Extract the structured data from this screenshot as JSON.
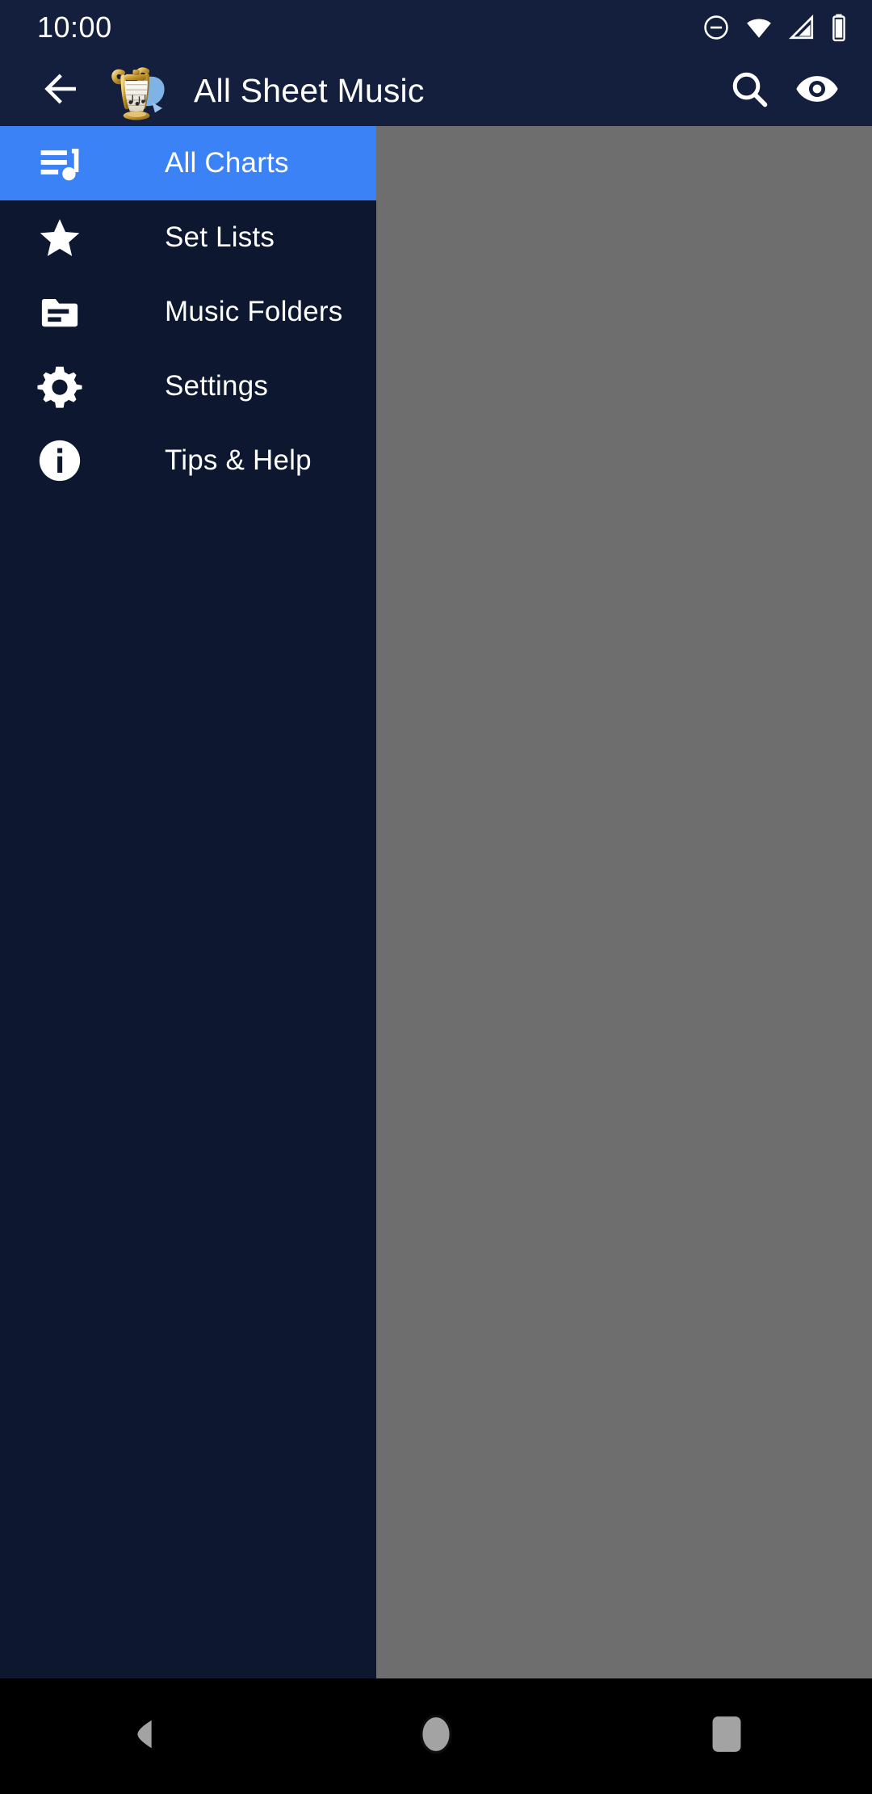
{
  "status_bar": {
    "time": "10:00",
    "icons": [
      "do-not-disturb-icon",
      "wifi-icon",
      "cell-signal-icon",
      "battery-icon"
    ]
  },
  "app_bar": {
    "back_label": "back-arrow-icon",
    "logo_label": "lyre-sheet-music-logo",
    "title": "All Sheet Music",
    "search_label": "search-icon",
    "visibility_label": "eye-icon"
  },
  "drawer": {
    "items": [
      {
        "label": "All Charts",
        "icon": "queue-music-icon",
        "selected": true
      },
      {
        "label": "Set Lists",
        "icon": "star-icon",
        "selected": false
      },
      {
        "label": "Music Folders",
        "icon": "folder-icon",
        "selected": false
      },
      {
        "label": "Settings",
        "icon": "gear-icon",
        "selected": false
      },
      {
        "label": "Tips & Help",
        "icon": "info-icon",
        "selected": false
      }
    ]
  },
  "nav_bar": {
    "back": "nav-back-icon",
    "home": "nav-home-icon",
    "recents": "nav-recents-icon"
  },
  "colors": {
    "status_bar": "#131f3d",
    "app_bar": "#131f3d",
    "drawer_bg": "#0d1730",
    "drawer_selected": "#3b82f6",
    "scrim": "#6e6e6e",
    "nav_bar": "#000000",
    "text": "#ffffff"
  }
}
